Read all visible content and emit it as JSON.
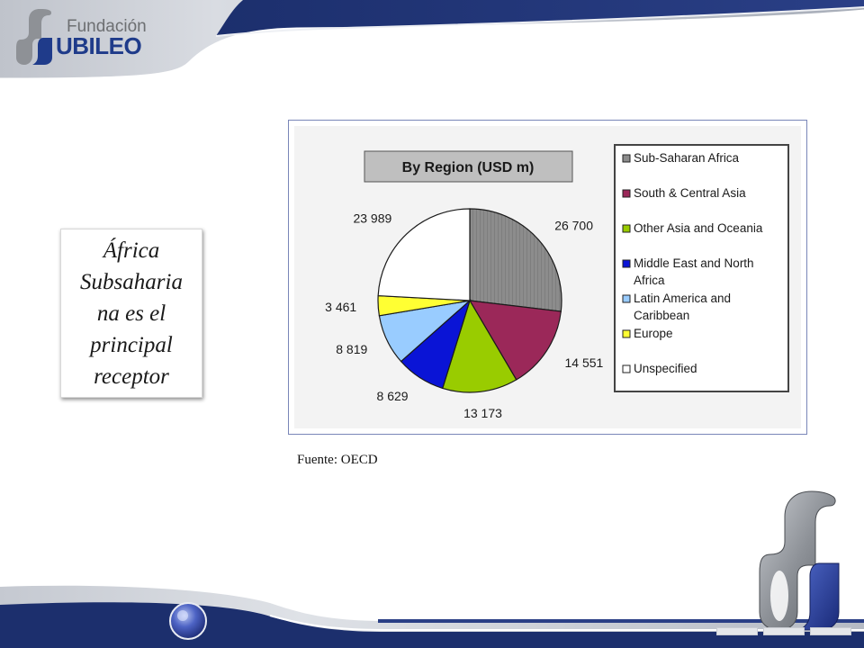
{
  "branding": {
    "logo_small": "Fundación",
    "logo_big": "UBILEO"
  },
  "text_box": {
    "lines": [
      "África",
      "Subsaharia",
      "na es el",
      "principal",
      "receptor"
    ]
  },
  "source": "Fuente: OECD",
  "chart_data": {
    "type": "pie",
    "title": "By Region (USD m)",
    "legend_position": "right",
    "slices": [
      {
        "label": "Sub-Saharan Africa",
        "value": 26700,
        "value_label": "26 700",
        "color": "#8c8c8c"
      },
      {
        "label": "South & Central Asia",
        "value": 14551,
        "value_label": "14 551",
        "color": "#9b2859"
      },
      {
        "label": "Other Asia and Oceania",
        "value": 13173,
        "value_label": "13 173",
        "color": "#99cc00"
      },
      {
        "label": "Middle East and North Africa",
        "value": 8629,
        "value_label": "8 629",
        "color": "#0a14d6"
      },
      {
        "label": "Latin America and Caribbean",
        "value": 8819,
        "value_label": "8 819",
        "color": "#99ccff"
      },
      {
        "label": "Europe",
        "value": 3461,
        "value_label": "3 461",
        "color": "#ffff33"
      },
      {
        "label": "Unspecified",
        "value": 23989,
        "value_label": "23 989",
        "color": "#ffffff"
      }
    ]
  }
}
